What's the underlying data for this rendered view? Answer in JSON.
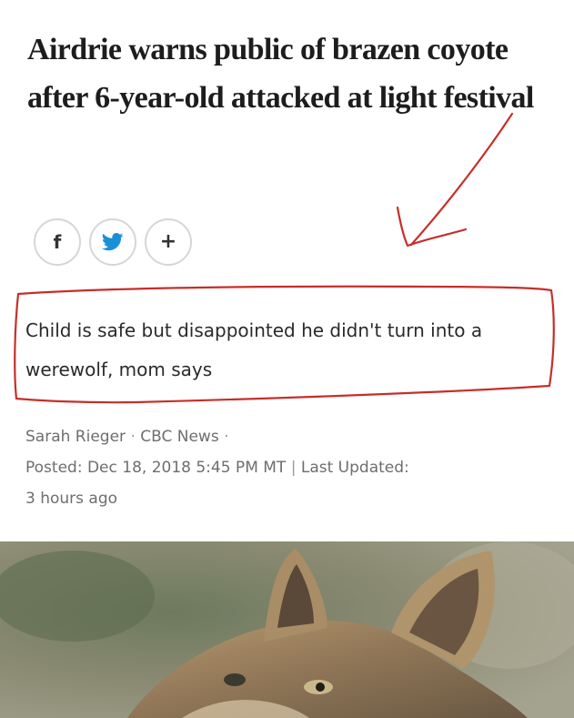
{
  "article": {
    "headline": "Airdrie warns public of brazen coyote after 6-year-old attacked at light festival",
    "subheadline": "Child is safe but disappointed he didn't turn into a werewolf, mom says",
    "author": "Sarah Rieger",
    "source": "CBC News",
    "byline_separator": "·",
    "posted_label": "Posted: Dec 18, 2018 5:45 PM MT",
    "divider": "|",
    "updated_label": "Last Updated:",
    "updated_value": "3 hours ago"
  },
  "share": {
    "facebook_icon": "f",
    "twitter_icon": "twitter-bird-icon",
    "more_icon": "+"
  },
  "colors": {
    "annotation_red": "#c62f2a",
    "twitter_blue": "#1a8fd8",
    "button_border": "#d6d6d6",
    "byline_gray": "#6e6e6e"
  },
  "image": {
    "subject": "coyote-photo"
  }
}
